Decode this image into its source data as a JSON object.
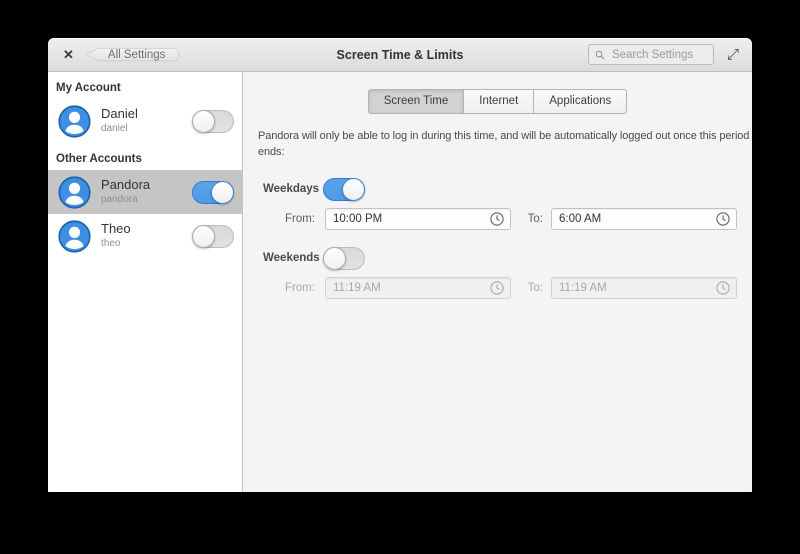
{
  "header": {
    "close_icon": "✕",
    "back_label": "All Settings",
    "title": "Screen Time & Limits",
    "search_placeholder": "Search Settings",
    "expand_icon": "⤢"
  },
  "sidebar": {
    "my_account_header": "My Account",
    "other_accounts_header": "Other Accounts",
    "users": [
      {
        "name": "Daniel",
        "username": "daniel",
        "enabled": false,
        "selected": false
      },
      {
        "name": "Pandora",
        "username": "pandora",
        "enabled": true,
        "selected": true
      },
      {
        "name": "Theo",
        "username": "theo",
        "enabled": false,
        "selected": false
      }
    ]
  },
  "main": {
    "tabs": [
      {
        "label": "Screen Time",
        "selected": true
      },
      {
        "label": "Internet",
        "selected": false
      },
      {
        "label": "Applications",
        "selected": false
      }
    ],
    "description": "Pandora will only be able to log in during this time, and will be automatically logged out once this period ends:",
    "weekdays": {
      "label": "Weekdays",
      "enabled": true,
      "from_label": "From:",
      "from_value": "10:00 PM",
      "to_label": "To:",
      "to_value": "6:00 AM"
    },
    "weekends": {
      "label": "Weekends",
      "enabled": false,
      "from_label": "From:",
      "from_value": "11:19 AM",
      "to_label": "To:",
      "to_value": "11:19 AM"
    }
  },
  "colors": {
    "accent_blue": "#4f9ae6",
    "avatar_blue": "#3d8fe4",
    "selected_row": "#c5c5c5",
    "header_gray": "#e4e4e4",
    "main_bg": "#f4f4f4"
  }
}
